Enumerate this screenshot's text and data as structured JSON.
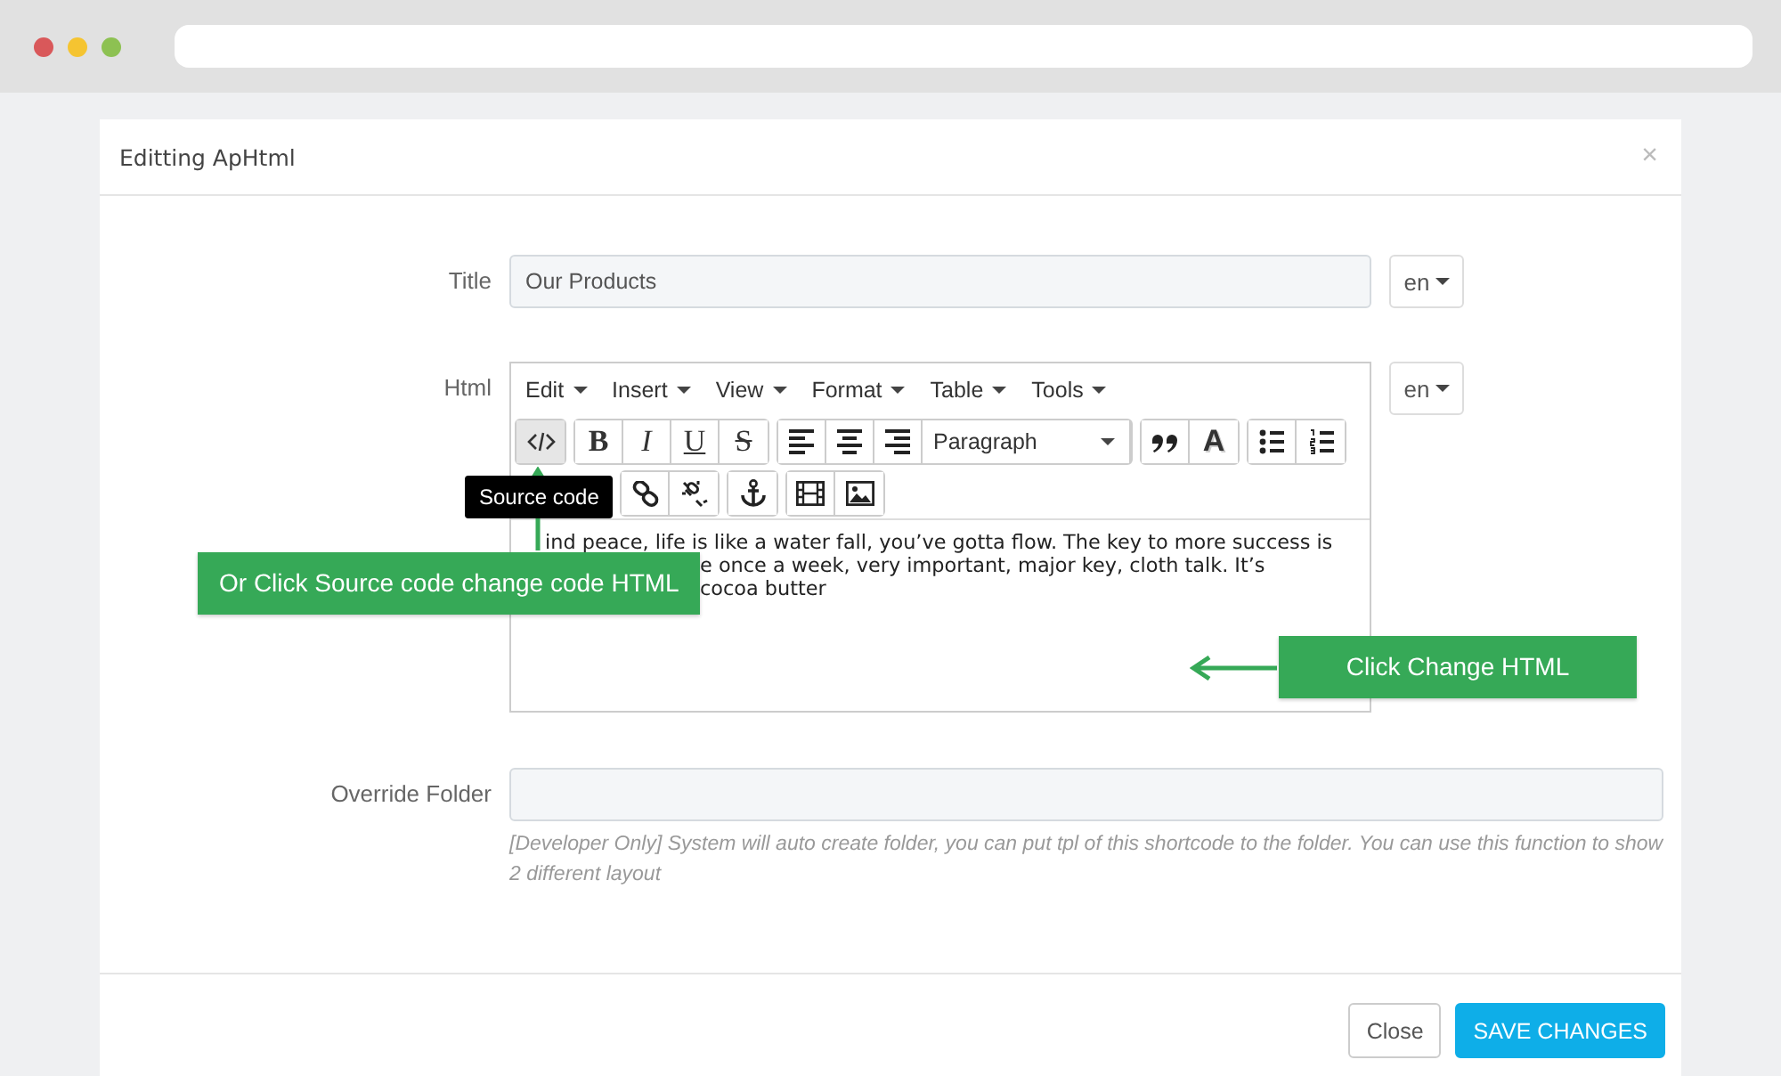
{
  "dialog": {
    "title": "Editting ApHtml",
    "close": "×"
  },
  "fields": [
    {
      "kind": "text",
      "label": "Title",
      "value": "Our Products",
      "language": "en"
    },
    {
      "kind": "editor",
      "label": "Html",
      "language": "en",
      "menu": [
        "Edit",
        "Insert",
        "View",
        "Format",
        "Table",
        "Tools"
      ],
      "toolbar": [
        [
          {
            "kind": "code",
            "active": true
          }
        ],
        [
          {
            "kind": "bold",
            "label": "B"
          },
          {
            "kind": "italic",
            "label": "I"
          },
          {
            "kind": "underline",
            "label": "U"
          },
          {
            "kind": "strike",
            "label": "S"
          }
        ],
        [
          {
            "kind": "align-left",
            "active": false
          },
          {
            "kind": "align-center",
            "active": false
          },
          {
            "kind": "align-right",
            "active": false
          },
          {
            "kind": "select",
            "label": "Paragraph"
          }
        ],
        [
          {
            "kind": "quote",
            "active": false
          },
          {
            "kind": "font-color",
            "label": "A"
          }
        ],
        [
          {
            "kind": "bullets",
            "active": false
          },
          {
            "kind": "numbers",
            "active": false
          }
        ]
      ],
      "toolbar_row2": [
        [
          {
            "kind": "link",
            "active": false
          },
          {
            "kind": "unlink",
            "active": false
          }
        ],
        [
          {
            "kind": "anchor",
            "active": false
          }
        ],
        [
          {
            "kind": "video",
            "active": false
          },
          {
            "kind": "image",
            "active": false
          }
        ]
      ],
      "content": [
        {
          "text": "ind peace, life is like a water fall, you’ve gotta flow. The key to more success is",
          "kind": "arrow-cut"
        },
        {
          "text": "e once a week, very important, major key, cloth talk. It’s",
          "kind": "callout-cut"
        },
        {
          "text": "cocoa butter",
          "kind": "callout-cut"
        }
      ]
    },
    {
      "kind": "folder",
      "label": "Override Folder",
      "help": "[Developer Only] System will auto create folder, you can put tpl of this shortcode to the folder. You can use this function to show 2 different layout"
    }
  ],
  "tooltip": "Source code",
  "callouts": [
    {
      "text": "Or Click Source code change code HTML",
      "kind": "pointing-up"
    },
    {
      "text": "Click Change HTML",
      "kind": "pointing-left"
    }
  ],
  "buttons": [
    {
      "label": "Close",
      "kind": "default"
    },
    {
      "label": "SAVE CHANGES",
      "kind": "primary"
    }
  ]
}
